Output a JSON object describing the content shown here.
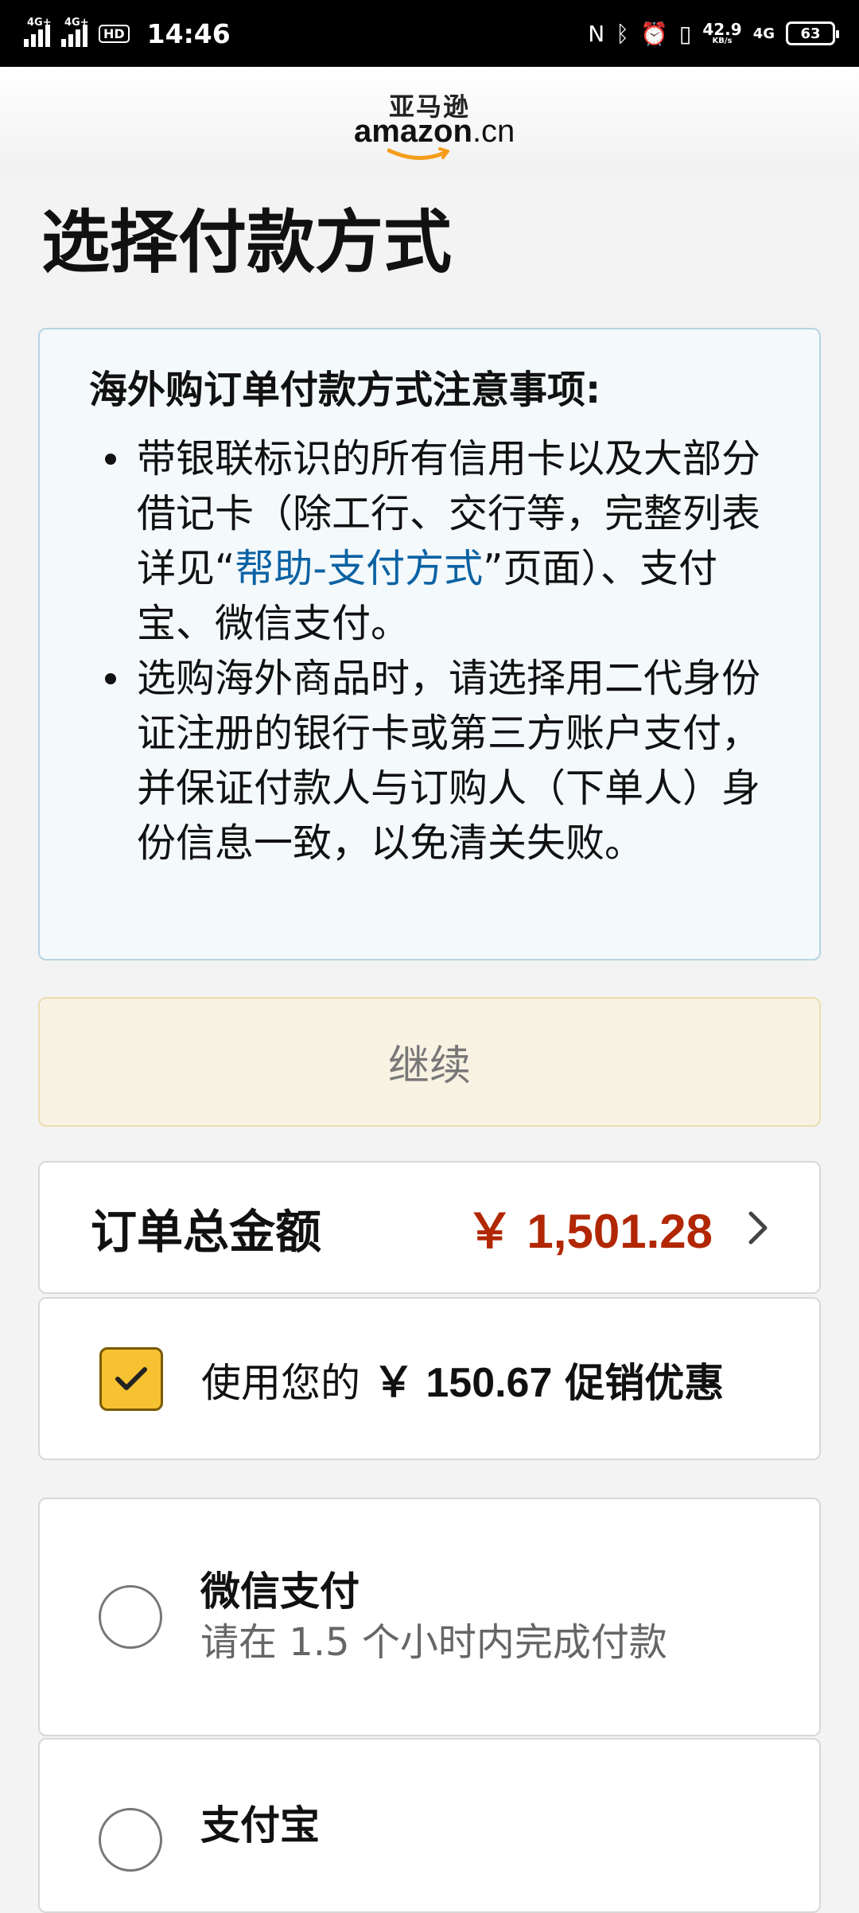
{
  "status_bar": {
    "signal1_label": "4G+",
    "signal2_label": "4G+",
    "hd_label": "HD",
    "time": "14:46",
    "net_speed": "42.9",
    "net_speed_unit": "KB/s",
    "net_type": "4G",
    "battery": "63"
  },
  "header": {
    "logo_cn": "亚马逊",
    "logo_en_brand": "amazon",
    "logo_en_tld": ".cn"
  },
  "page": {
    "title": "选择付款方式"
  },
  "notice": {
    "title": "海外购订单付款方式注意事项:",
    "item1_before": "带银联标识的所有信用卡以及大部分借记卡（除工行、交行等，完整列表详见“",
    "item1_link": "帮助-支付方式",
    "item1_after": "”页面）、支付宝、微信支付。",
    "item2": "选购海外商品时，请选择用二代身份证注册的银行卡或第三方账户支付，并保证付款人与订购人（下单人）身份信息一致，以免清关失败。"
  },
  "continue_label": "继续",
  "order_total": {
    "label": "订单总金额",
    "amount": "￥ 1,501.28"
  },
  "promo": {
    "prefix": "使用您的",
    "amount": "￥ 150.67",
    "suffix": "促销优惠",
    "checked": true
  },
  "payment_methods": [
    {
      "name": "微信支付",
      "note": "请在 1.5 个小时内完成付款"
    },
    {
      "name": "支付宝"
    }
  ],
  "colors": {
    "price_red": "#b12704",
    "link_blue": "#0b62a3",
    "checkbox_yellow": "#f7c231",
    "smile_orange": "#f49e1c"
  }
}
